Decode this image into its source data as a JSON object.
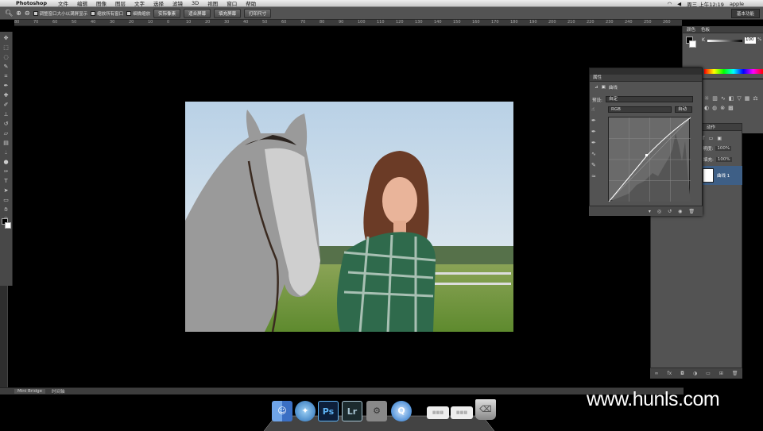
{
  "menubar": {
    "app_name": "Photoshop",
    "items": [
      "文件",
      "编辑",
      "图像",
      "图层",
      "文字",
      "选择",
      "滤镜",
      "3D",
      "视图",
      "窗口",
      "帮助"
    ],
    "clock": "周三 上午12:19",
    "user": "apple"
  },
  "options_bar": {
    "chk_resize": "调整窗口大小以满屏显示",
    "chk_zoom_all": "缩放所有窗口",
    "chk_scrubby": "细微缩放",
    "btn_actual": "实际像素",
    "btn_fit": "适合屏幕",
    "btn_fill": "填充屏幕",
    "btn_print": "打印尺寸",
    "workspace": "基本功能"
  },
  "ruler_ticks": [
    "80",
    "70",
    "60",
    "50",
    "40",
    "30",
    "20",
    "10",
    "0",
    "10",
    "20",
    "30",
    "40",
    "50",
    "60",
    "70",
    "80",
    "90",
    "100",
    "110",
    "120",
    "130",
    "140",
    "150",
    "160",
    "170",
    "180",
    "190",
    "200",
    "210",
    "220",
    "230",
    "240",
    "250",
    "260"
  ],
  "bottom_tabs": {
    "mini_bridge": "Mini Bridge",
    "timeline": "时间轴"
  },
  "color_panel": {
    "tab1": "颜色",
    "tab2": "色板",
    "channel": "K",
    "value": "100",
    "unit": "%"
  },
  "properties_panel": {
    "title": "属性",
    "adjustment_name": "曲线",
    "preset_label": "预设:",
    "preset_value": "自定",
    "channel_value": "RGB",
    "auto_button": "自动"
  },
  "layers_panel": {
    "tab": "动作",
    "opacity_label": "透明度:",
    "opacity_value": "100%",
    "fill_label": "填充:",
    "fill_value": "100%",
    "layer_name": "曲线 1"
  },
  "watermark": "www.hunls.com",
  "dock": {
    "ps": "Ps",
    "lr": "Lr"
  },
  "colors": {
    "ui_bg": "#535353",
    "selected_layer": "#3e5f86"
  }
}
